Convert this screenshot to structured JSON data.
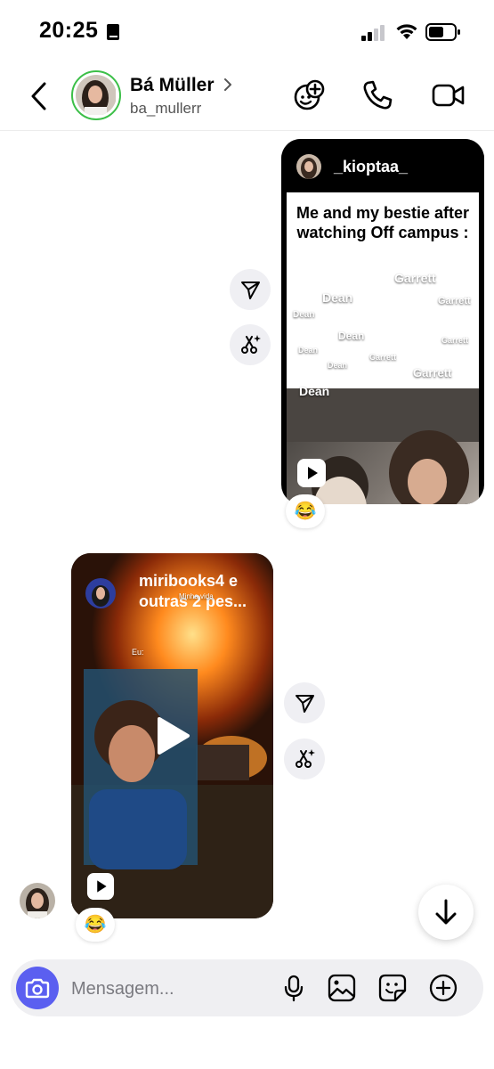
{
  "status_bar": {
    "time": "20:25"
  },
  "header": {
    "name": "Bá Müller",
    "username": "ba_mullerr"
  },
  "messages": [
    {
      "account": "_kioptaa_",
      "caption": "Me and my bestie after watching Off campus :",
      "overlay_labels": [
        "Garrett",
        "Dean",
        "Garrett",
        "Dean",
        "Dean",
        "Garrett",
        "Dean",
        "Dean",
        "Garrett",
        "Garrett",
        "Dean"
      ],
      "reaction": "😂"
    },
    {
      "account_line1": "miribooks4 e",
      "account_line2": "outras 2 pes...",
      "overlay_small1": "Minha vida",
      "overlay_small2": "Eu:",
      "reaction": "😂"
    }
  ],
  "composer": {
    "placeholder": "Mensagem..."
  },
  "colors": {
    "accent": "#5b5ff0",
    "story_ring": "#3cbf48"
  }
}
